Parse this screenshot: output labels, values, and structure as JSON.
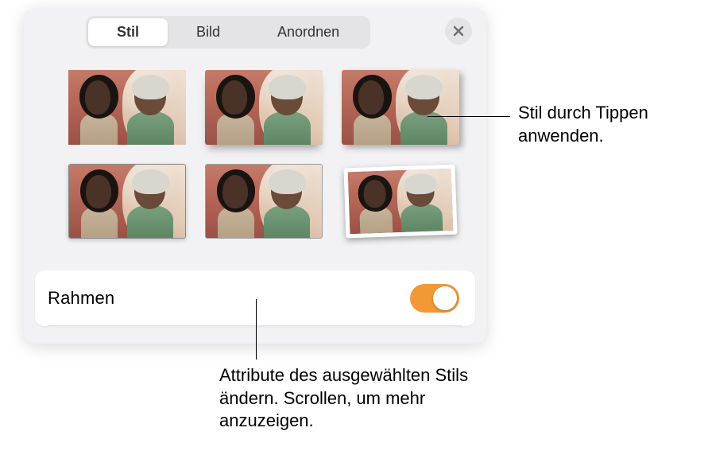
{
  "tabs": {
    "stil": "Stil",
    "bild": "Bild",
    "anordnen": "Anordnen",
    "active": "stil"
  },
  "close_icon": "close-icon",
  "style_thumbnails": [
    {
      "name": "style-plain"
    },
    {
      "name": "style-reflection"
    },
    {
      "name": "style-drop-shadow"
    },
    {
      "name": "style-thin-border-shadow"
    },
    {
      "name": "style-outline"
    },
    {
      "name": "style-polaroid-tilt"
    }
  ],
  "frame": {
    "label": "Rahmen",
    "enabled": true
  },
  "callouts": {
    "apply_style": "Stil durch Tippen anwenden.",
    "edit_attributes": "Attribute des ausgewählten Stils ändern. Scrollen, um mehr anzuzeigen."
  }
}
